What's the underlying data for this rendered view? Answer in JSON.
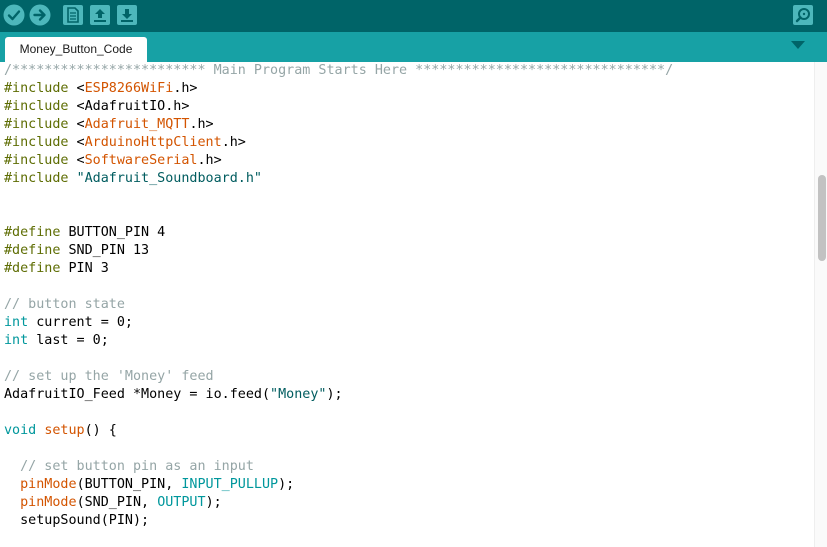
{
  "toolbar": {
    "buttons": [
      {
        "name": "verify",
        "icon": "checkmark-icon"
      },
      {
        "name": "upload",
        "icon": "arrow-right-icon"
      },
      {
        "name": "new",
        "icon": "new-file-icon"
      },
      {
        "name": "open",
        "icon": "open-arrow-up-icon"
      },
      {
        "name": "save",
        "icon": "save-arrow-down-icon"
      },
      {
        "name": "serial-monitor",
        "icon": "magnifier-icon"
      }
    ]
  },
  "tabs": [
    {
      "label": "Money_Button_Code",
      "active": true
    }
  ],
  "code_lines": [
    [
      [
        "comment",
        "/************************ Main Program Starts Here *******************************/"
      ]
    ],
    [
      [
        "pre",
        "#include"
      ],
      [
        "plain",
        " <"
      ],
      [
        "lib",
        "ESP8266WiFi"
      ],
      [
        "plain",
        ".h>"
      ]
    ],
    [
      [
        "pre",
        "#include"
      ],
      [
        "plain",
        " <AdafruitIO.h>"
      ]
    ],
    [
      [
        "pre",
        "#include"
      ],
      [
        "plain",
        " <"
      ],
      [
        "lib",
        "Adafruit_MQTT"
      ],
      [
        "plain",
        ".h>"
      ]
    ],
    [
      [
        "pre",
        "#include"
      ],
      [
        "plain",
        " <"
      ],
      [
        "lib",
        "ArduinoHttpClient"
      ],
      [
        "plain",
        ".h>"
      ]
    ],
    [
      [
        "pre",
        "#include"
      ],
      [
        "plain",
        " <"
      ],
      [
        "lib",
        "SoftwareSerial"
      ],
      [
        "plain",
        ".h>"
      ]
    ],
    [
      [
        "pre",
        "#include"
      ],
      [
        "plain",
        " "
      ],
      [
        "str",
        "\"Adafruit_Soundboard.h\""
      ]
    ],
    [],
    [],
    [
      [
        "pre",
        "#define"
      ],
      [
        "plain",
        " BUTTON_PIN 4"
      ]
    ],
    [
      [
        "pre",
        "#define"
      ],
      [
        "plain",
        " SND_PIN 13"
      ]
    ],
    [
      [
        "pre",
        "#define"
      ],
      [
        "plain",
        " PIN 3"
      ]
    ],
    [],
    [
      [
        "comment",
        "// button state"
      ]
    ],
    [
      [
        "type",
        "int"
      ],
      [
        "plain",
        " current = 0;"
      ]
    ],
    [
      [
        "type",
        "int"
      ],
      [
        "plain",
        " last = 0;"
      ]
    ],
    [],
    [
      [
        "comment",
        "// set up the 'Money' feed"
      ]
    ],
    [
      [
        "plain",
        "AdafruitIO_Feed *Money = io.feed("
      ],
      [
        "str",
        "\"Money\""
      ],
      [
        "plain",
        ");"
      ]
    ],
    [],
    [
      [
        "type",
        "void"
      ],
      [
        "plain",
        " "
      ],
      [
        "func",
        "setup"
      ],
      [
        "plain",
        "() {"
      ]
    ],
    [],
    [
      [
        "plain",
        "  "
      ],
      [
        "comment",
        "// set button pin as an input"
      ]
    ],
    [
      [
        "plain",
        "  "
      ],
      [
        "func",
        "pinMode"
      ],
      [
        "plain",
        "(BUTTON_PIN, "
      ],
      [
        "const",
        "INPUT_PULLUP"
      ],
      [
        "plain",
        ");"
      ]
    ],
    [
      [
        "plain",
        "  "
      ],
      [
        "func",
        "pinMode"
      ],
      [
        "plain",
        "(SND_PIN, "
      ],
      [
        "const",
        "OUTPUT"
      ],
      [
        "plain",
        ");"
      ]
    ],
    [
      [
        "plain",
        "  setupSound(PIN);"
      ]
    ]
  ],
  "colors": {
    "toolbar_bg": "#006468",
    "tabbar_bg": "#17a1a5",
    "comment": "#95a5a6",
    "preprocessor": "#5e6d03",
    "library": "#d35400",
    "string": "#005c5f",
    "keyword_type": "#00979c",
    "function": "#d35400"
  }
}
